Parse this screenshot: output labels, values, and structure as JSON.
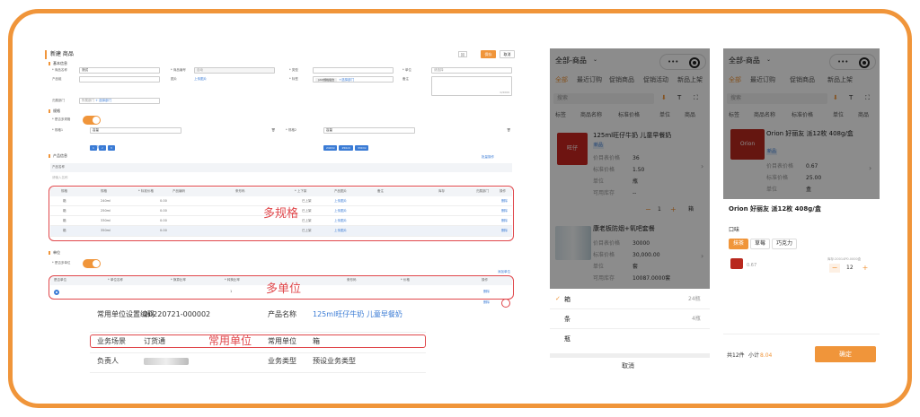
{
  "pc": {
    "title": "新建 商品",
    "btn_save": "保存",
    "btn_cancel": "取消",
    "section_basic": "基本信息",
    "lbl_name": "* 商品名称",
    "val_name": "测试",
    "lbl_code": "* 商品编号",
    "val_code": "自动",
    "lbl_cat": "* 类型",
    "lbl_unit": "* 单位",
    "val_unit": "请选择",
    "lbl_prod": "产品组",
    "lbl_pic": "图片",
    "pic_link": "上传图片",
    "lbl_tag": "* 标签",
    "tag1": "(22)规格组合",
    "tag2": "+选择部门",
    "lbl_memo": "备注",
    "memo_count": "0/2000",
    "lbl_dept": "归属部门",
    "dept_val": "所属部门",
    "dept_link": "+ 选择部门",
    "section_spec": "规格",
    "lbl_multispec": "* 是否多规格",
    "lbl_spec1": "* 规格1",
    "spec1_val": "容量",
    "spec1_tags": [
      "1",
      "2",
      "3"
    ],
    "lbl_spec2": "* 规格2",
    "spec2_val": "容量",
    "spec2_tags": [
      "240ml",
      "250ml",
      "330ml"
    ],
    "add_spec": "+ 添加规格",
    "section_product": "产品信息",
    "batch_btn": "批量操作",
    "product_name_hdr": "产品名称",
    "product_name_val": "请输入名称",
    "spec_headers": [
      "规格",
      "规格",
      "* 标准价格",
      "产品编码",
      "",
      "条形码",
      "* 上下架",
      "产品图片",
      "备注",
      "库存",
      "",
      "归属部门",
      "操作"
    ],
    "spec_rows": [
      {
        "a": "箱",
        "b": "240ml",
        "price": "0.00",
        "status": "已上架",
        "img": "上传图片",
        "op": "删除"
      },
      {
        "a": "箱",
        "b": "250ml",
        "price": "0.00",
        "status": "已上架",
        "img": "上传图片",
        "op": "删除"
      },
      {
        "a": "箱",
        "b": "330ml",
        "price": "0.00",
        "status": "已上架",
        "img": "上传图片",
        "op": "删除"
      },
      {
        "a": "箱",
        "b": "350ml",
        "price": "0.00",
        "status": "已上架",
        "img": "上传图片",
        "op": "删除"
      }
    ],
    "label_multispec": "多规格",
    "section_unit": "单位",
    "lbl_multiunit": "* 是否多单位",
    "add_unit": "添加单位",
    "unit_headers": [
      "是否单位",
      "* 单位名称",
      "* 换算比率",
      "* 转换比率",
      "条形码",
      "* 价格",
      "操作"
    ],
    "unit_row": {
      "ratio": "1",
      "op": "删除"
    },
    "unit_row2_op": "删除",
    "label_multiunit": "多单位",
    "detail": {
      "lbl_unit_code": "常用单位设置编码",
      "val_unit_code": "20220721-000002",
      "lbl_prod_name": "产品名称",
      "val_prod_name": "125ml旺仔牛奶 儿童早餐奶",
      "lbl_scene": "业务场景",
      "val_scene": "订货通",
      "lbl_common_unit": "常用单位",
      "val_common_unit": "箱",
      "lbl_owner": "负责人",
      "val_owner": "",
      "lbl_biz_type": "业务类型",
      "val_biz_type": "预设业务类型",
      "label_common": "常用单位"
    }
  },
  "phone1": {
    "title": "全部-商品",
    "tabs": [
      "全部",
      "最近订购",
      "促销商品",
      "促销活动",
      "新品上架"
    ],
    "search": "搜索",
    "filters": [
      "标签",
      "商品名称",
      "标准价格",
      "单位",
      "商品"
    ],
    "item1": {
      "name": "125ml旺仔牛奶 儿童早餐奶",
      "tag": "新品",
      "lbl_price": "价目表价格",
      "price": "36",
      "lbl_std": "标准价格",
      "std": "1.50",
      "lbl_unit": "单位",
      "unit": "瓶",
      "lbl_stock": "可用库存",
      "stock": "--",
      "qty": "1",
      "unit_btn": "箱"
    },
    "item2": {
      "name": "康老板防烟+氧吧套餐",
      "lbl_price": "价目表价格",
      "price": "30000",
      "lbl_std": "标准价格",
      "std": "30,000.00",
      "lbl_unit": "单位",
      "unit": "套",
      "lbl_stock": "可用库存",
      "stock": "10087.0000套"
    },
    "sheet": [
      {
        "label": "箱",
        "count": "24瓶",
        "selected": true
      },
      {
        "label": "条",
        "count": "4瓶",
        "selected": false
      },
      {
        "label": "瓶",
        "count": "",
        "selected": false
      }
    ],
    "cancel": "取消"
  },
  "phone2": {
    "title": "全部-商品",
    "tabs": [
      "全部",
      "最近订购",
      "促销商品",
      "新品上架"
    ],
    "search": "搜索",
    "filters": [
      "标签",
      "商品名称",
      "标准价格",
      "单位",
      "商品"
    ],
    "item": {
      "name": "Orion 好丽友 派12枚 408g/盒",
      "tag": "新品",
      "lbl_price": "价目表价格",
      "price": "0.67",
      "lbl_std": "标准价格",
      "std": "25.00",
      "lbl_unit": "单位",
      "unit": "盒"
    },
    "sheet_title": "Orion 好丽友 派12枚 408g/盒",
    "sheet_attr": "口味",
    "options": [
      "抹茶",
      "草莓",
      "巧克力"
    ],
    "sku_price": "0.67",
    "sku_stock": "库存:20014P0.0000盒",
    "qty": "12",
    "total_label": "共12件",
    "subtotal_label": "小计",
    "subtotal": "8.04",
    "confirm": "确定"
  }
}
